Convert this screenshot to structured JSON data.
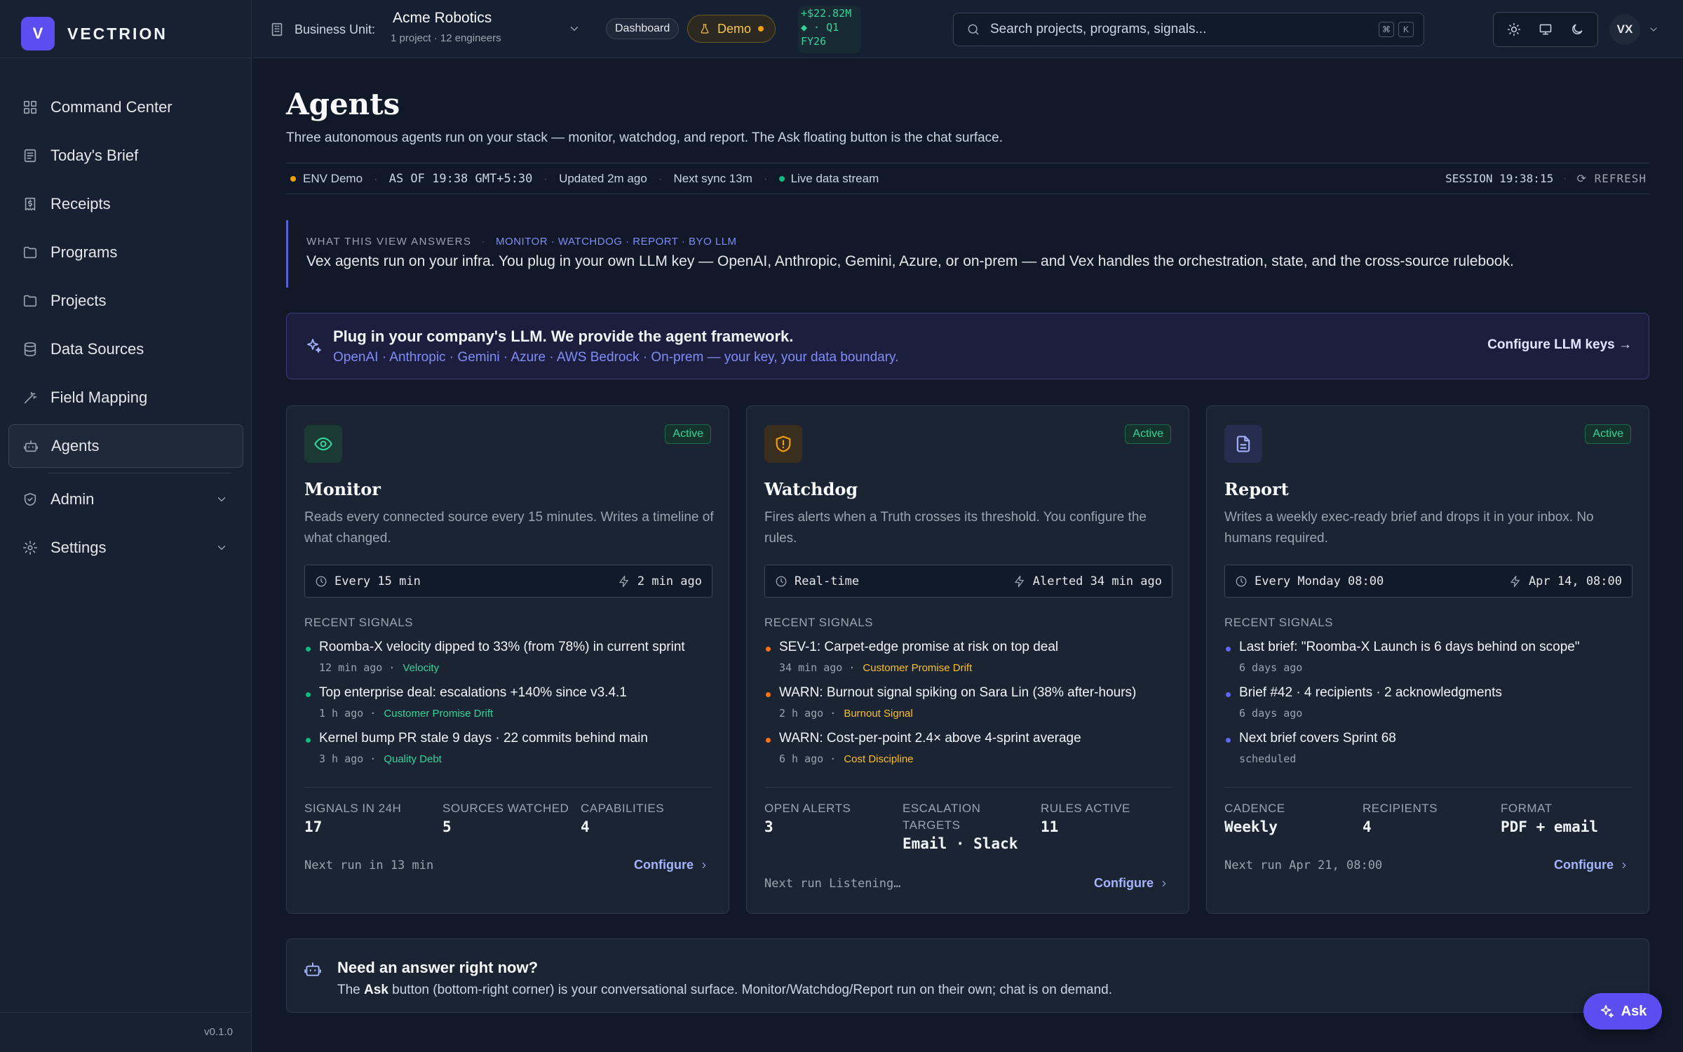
{
  "brand": {
    "logo_letter": "V",
    "name": "VECTRION"
  },
  "nav": [
    {
      "label": "Command Center",
      "icon": "grid-icon"
    },
    {
      "label": "Today's Brief",
      "icon": "newspaper-icon"
    },
    {
      "label": "Receipts",
      "icon": "receipt-icon"
    },
    {
      "label": "Programs",
      "icon": "folder-icon"
    },
    {
      "label": "Projects",
      "icon": "folder-icon"
    },
    {
      "label": "Data Sources",
      "icon": "database-icon"
    },
    {
      "label": "Field Mapping",
      "icon": "wand-icon"
    },
    {
      "label": "Agents",
      "icon": "bot-icon",
      "active": true
    },
    {
      "label": "Admin",
      "icon": "shield-check-icon"
    },
    {
      "label": "Settings",
      "icon": "gear-icon"
    }
  ],
  "version": "v0.1.0",
  "topbar": {
    "bu_label": "Business Unit:",
    "bu_name": "Acme Robotics",
    "bu_sub": "1 project · 12 engineers",
    "dashboard_badge": "Dashboard",
    "demo_badge": "Demo",
    "ticker": [
      "+$22.82M",
      "◆ · Q1",
      "FY26"
    ],
    "search_placeholder": "Search projects, programs, signals...",
    "kbd": [
      "⌘",
      "K"
    ],
    "avatar": "VX"
  },
  "page": {
    "title": "Agents",
    "subtitle": "Three autonomous agents run on your stack — monitor, watchdog, and report. The Ask floating button is the chat surface."
  },
  "status": {
    "env": "ENV Demo",
    "as_of": "AS OF 19:38 GMT+5:30",
    "updated": "Updated 2m ago",
    "next_sync": "Next sync 13m",
    "live": "Live data stream",
    "session": "SESSION 19:38:15",
    "refresh": "⟳ REFRESH"
  },
  "answers": {
    "heading": "WHAT THIS VIEW ANSWERS",
    "tags": "MONITOR · WATCHDOG · REPORT · BYO LLM",
    "text": "Vex agents run on your infra. You plug in your own LLM key — OpenAI, Anthropic, Gemini, Azure, or on-prem — and Vex handles the orchestration, state, and the cross-source rulebook."
  },
  "llm_banner": {
    "title": "Plug in your company's LLM. We provide the agent framework.",
    "subtitle": "OpenAI · Anthropic · Gemini · Azure · AWS Bedrock · On-prem — your key, your data boundary.",
    "link": "Configure LLM keys →"
  },
  "cards": [
    {
      "name": "Monitor",
      "status": "Active",
      "icon": "eye-icon",
      "desc": "Reads every connected source every 15 minutes. Writes a timeline of what changed.",
      "schedule_left": "Every 15 min",
      "schedule_right": "2 min ago",
      "signals_heading": "RECENT SIGNALS",
      "signals": [
        {
          "text": "Roomba-X velocity dipped to 33% (from 78%) in current sprint",
          "time": "12 min ago ·",
          "tag": "Velocity"
        },
        {
          "text": "Top enterprise deal: escalations +140% since v3.4.1",
          "time": "1 h ago ·",
          "tag": "Customer Promise Drift"
        },
        {
          "text": "Kernel bump PR stale 9 days · 22 commits behind main",
          "time": "3 h ago ·",
          "tag": "Quality Debt"
        }
      ],
      "stats": [
        {
          "k": "SIGNALS IN 24H",
          "v": "17"
        },
        {
          "k": "SOURCES WATCHED",
          "v": "5"
        },
        {
          "k": "CAPABILITIES",
          "v": "4"
        }
      ],
      "next_run": "Next run in 13 min",
      "configure": "Configure"
    },
    {
      "name": "Watchdog",
      "status": "Active",
      "icon": "shield-alert-icon",
      "desc": "Fires alerts when a Truth crosses its threshold. You configure the rules.",
      "schedule_left": "Real-time",
      "schedule_right": "Alerted 34 min ago",
      "signals_heading": "RECENT SIGNALS",
      "signals": [
        {
          "text": "SEV-1: Carpet-edge promise at risk on top deal",
          "time": "34 min ago ·",
          "tag": "Customer Promise Drift"
        },
        {
          "text": "WARN: Burnout signal spiking on Sara Lin (38% after-hours)",
          "time": "2 h ago ·",
          "tag": "Burnout Signal"
        },
        {
          "text": "WARN: Cost-per-point 2.4× above 4-sprint average",
          "time": "6 h ago ·",
          "tag": "Cost Discipline"
        }
      ],
      "stats": [
        {
          "k": "OPEN ALERTS",
          "v": "3"
        },
        {
          "k": "ESCALATION TARGETS",
          "v": "Email · Slack"
        },
        {
          "k": "RULES ACTIVE",
          "v": "11"
        }
      ],
      "next_run": "Next run Listening…",
      "configure": "Configure"
    },
    {
      "name": "Report",
      "status": "Active",
      "icon": "document-icon",
      "desc": "Writes a weekly exec-ready brief and drops it in your inbox. No humans required.",
      "schedule_left": "Every Monday 08:00",
      "schedule_right": "Apr 14, 08:00",
      "signals_heading": "RECENT SIGNALS",
      "signals": [
        {
          "text": "Last brief: \"Roomba-X Launch is 6 days behind on scope\"",
          "time": "6 days ago",
          "tag": ""
        },
        {
          "text": "Brief #42 · 4 recipients · 2 acknowledgments",
          "time": "6 days ago",
          "tag": ""
        },
        {
          "text": "Next brief covers Sprint 68",
          "time": "scheduled",
          "tag": ""
        }
      ],
      "stats": [
        {
          "k": "CADENCE",
          "v": "Weekly"
        },
        {
          "k": "RECIPIENTS",
          "v": "4"
        },
        {
          "k": "FORMAT",
          "v": "PDF + email"
        }
      ],
      "next_run": "Next run Apr 21, 08:00",
      "configure": "Configure"
    }
  ],
  "need": {
    "title": "Need an answer right now?",
    "text_pre": "The ",
    "text_bold": "Ask",
    "text_post": " button (bottom-right corner) is your conversational surface. Monitor/Watchdog/Report run on their own; chat is on demand."
  },
  "ask_button": "Ask",
  "colors": {
    "accent": "#5b4ef0",
    "monitor": "#10b981",
    "watchdog": "#f59e0b",
    "report": "#6366f1",
    "active_badge": "#34d399"
  }
}
